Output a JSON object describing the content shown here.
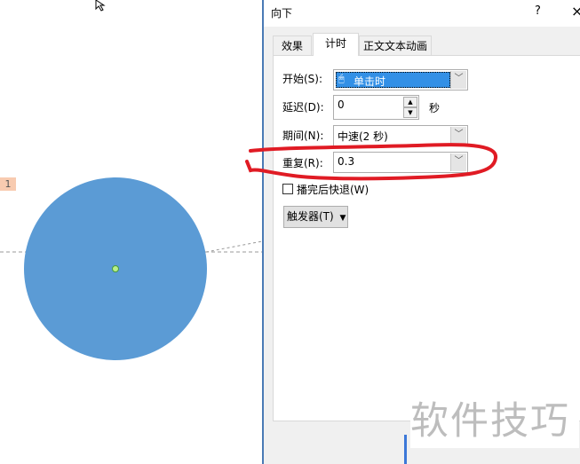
{
  "slide": {
    "anim_badge": "1",
    "shape_color": "#5b9bd5"
  },
  "dialog": {
    "title": "向下",
    "help": "?",
    "close": "×",
    "tabs": [
      {
        "label": "效果"
      },
      {
        "label": "计时"
      },
      {
        "label": "正文文本动画"
      }
    ],
    "start": {
      "label": "开始(S):",
      "value": "单击时"
    },
    "delay": {
      "label": "延迟(D):",
      "value": "0",
      "unit": "秒"
    },
    "duration": {
      "label": "期间(N):",
      "value": "中速(2 秒)"
    },
    "repeat": {
      "label": "重复(R):",
      "value": "0.3"
    },
    "rewind": {
      "label": "播完后快退(W)",
      "checked": false
    },
    "triggers": {
      "label": "触发器(T)"
    }
  },
  "watermark": "软件技巧",
  "annotation_color": "#e01b24"
}
